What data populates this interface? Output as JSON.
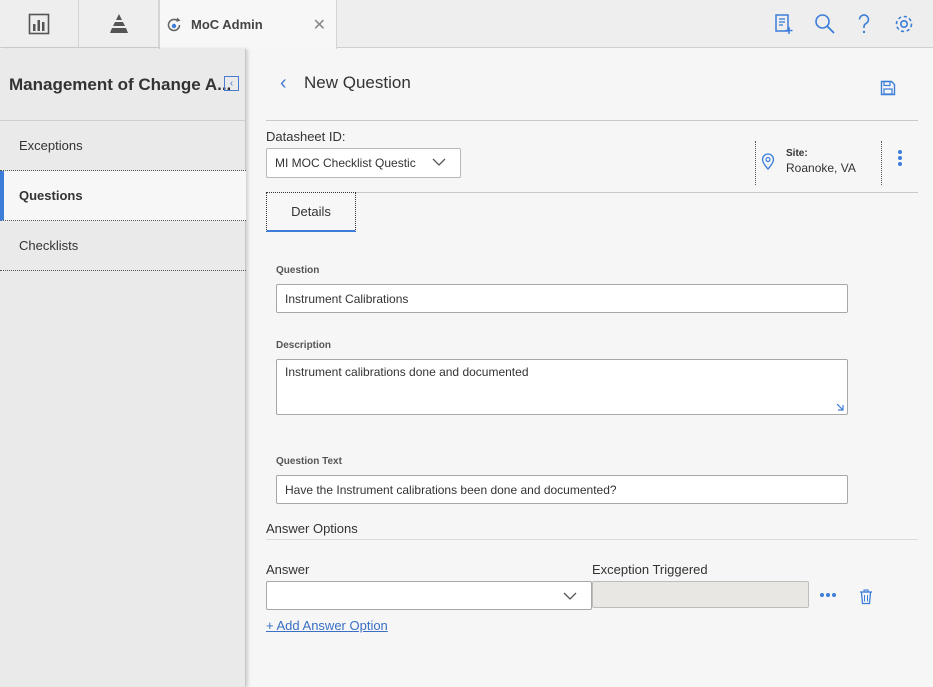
{
  "topbar": {
    "tab": {
      "title": "MoC Admin"
    },
    "icons": [
      "dashboard-icon",
      "pyramid-icon",
      "new-record-icon",
      "search-icon",
      "help-icon",
      "settings-icon"
    ]
  },
  "sidebar": {
    "title": "Management of Change A...",
    "items": [
      {
        "label": "Exceptions",
        "active": false
      },
      {
        "label": "Questions",
        "active": true
      },
      {
        "label": "Checklists",
        "active": false
      }
    ]
  },
  "main": {
    "page_title": "New Question",
    "datasheet": {
      "label": "Datasheet ID:",
      "value": "MI MOC Checklist Questic"
    },
    "site": {
      "label": "Site:",
      "value": "Roanoke, VA"
    },
    "tabs": [
      {
        "label": "Details"
      }
    ],
    "fields": {
      "question": {
        "label": "Question",
        "value": "Instrument Calibrations"
      },
      "description": {
        "label": "Description",
        "value": "Instrument calibrations done and documented"
      },
      "question_text": {
        "label": "Question Text",
        "value": "Have the Instrument calibrations been done and documented?"
      }
    },
    "answer_options": {
      "title": "Answer Options",
      "answer_header": "Answer",
      "exception_header": "Exception Triggered",
      "answer_value": "",
      "add_label": "Add Answer Option",
      "add_symbol": "+"
    }
  },
  "colors": {
    "accent": "#3c7dd9",
    "link": "#3a6fc4"
  }
}
